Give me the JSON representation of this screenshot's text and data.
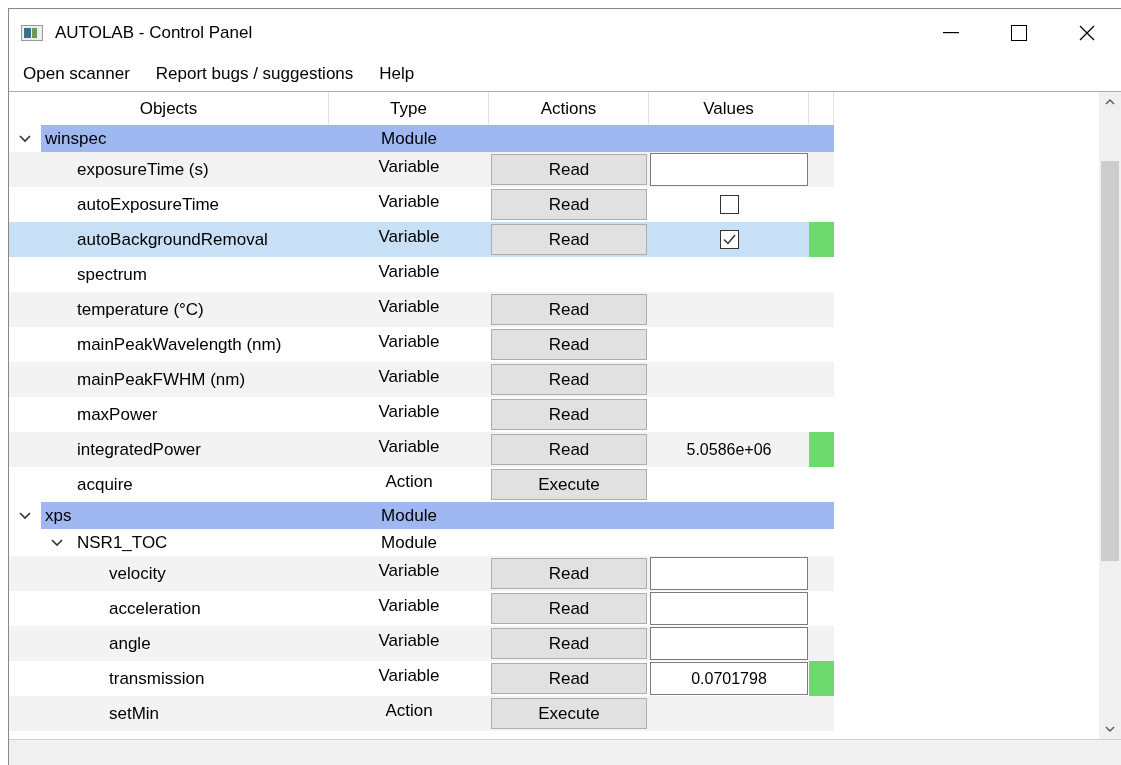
{
  "window": {
    "title": "AUTOLAB - Control Panel"
  },
  "menu": [
    "Open scanner",
    "Report bugs / suggestions",
    "Help"
  ],
  "tree": {
    "columns": [
      "Objects",
      "Type",
      "Actions",
      "Values"
    ],
    "items": [
      {
        "name": "winspec",
        "type": "Module",
        "expanded": true,
        "children": [
          {
            "name": "exposureTime (s)",
            "type": "Variable",
            "action": "Read",
            "value": {
              "kind": "field"
            },
            "indicator": false,
            "selected": false
          },
          {
            "name": "autoExposureTime",
            "type": "Variable",
            "action": "Read",
            "value": {
              "kind": "checkbox",
              "checked": false
            },
            "indicator": false,
            "selected": false
          },
          {
            "name": "autoBackgroundRemoval",
            "type": "Variable",
            "action": "Read",
            "value": {
              "kind": "checkbox",
              "checked": true
            },
            "indicator": true,
            "selected": true
          },
          {
            "name": "spectrum",
            "type": "Variable",
            "indicator": false,
            "selected": false
          },
          {
            "name": "temperature (°C)",
            "type": "Variable",
            "action": "Read",
            "indicator": false,
            "selected": false
          },
          {
            "name": "mainPeakWavelength (nm)",
            "type": "Variable",
            "action": "Read",
            "indicator": false,
            "selected": false
          },
          {
            "name": "mainPeakFWHM (nm)",
            "type": "Variable",
            "action": "Read",
            "indicator": false,
            "selected": false
          },
          {
            "name": "maxPower",
            "type": "Variable",
            "action": "Read",
            "indicator": false,
            "selected": false
          },
          {
            "name": "integratedPower",
            "type": "Variable",
            "action": "Read",
            "value": {
              "kind": "text",
              "text": "5.0586e+06"
            },
            "indicator": true,
            "selected": false
          },
          {
            "name": "acquire",
            "type": "Action",
            "action": "Execute",
            "indicator": false,
            "selected": false
          }
        ]
      },
      {
        "name": "xps",
        "type": "Module",
        "expanded": true,
        "children": [
          {
            "name": "NSR1_TOC",
            "type": "Module",
            "expanded": true,
            "children": [
              {
                "name": "velocity",
                "type": "Variable",
                "action": "Read",
                "value": {
                  "kind": "field"
                },
                "indicator": false,
                "selected": false
              },
              {
                "name": "acceleration",
                "type": "Variable",
                "action": "Read",
                "value": {
                  "kind": "field"
                },
                "indicator": false,
                "selected": false
              },
              {
                "name": "angle",
                "type": "Variable",
                "action": "Read",
                "value": {
                  "kind": "field"
                },
                "indicator": false,
                "selected": false
              },
              {
                "name": "transmission",
                "type": "Variable",
                "action": "Read",
                "value": {
                  "kind": "field",
                  "text": "0.0701798"
                },
                "indicator": true,
                "selected": false
              },
              {
                "name": "setMin",
                "type": "Action",
                "action": "Execute",
                "indicator": false,
                "selected": false
              }
            ]
          }
        ]
      }
    ]
  }
}
